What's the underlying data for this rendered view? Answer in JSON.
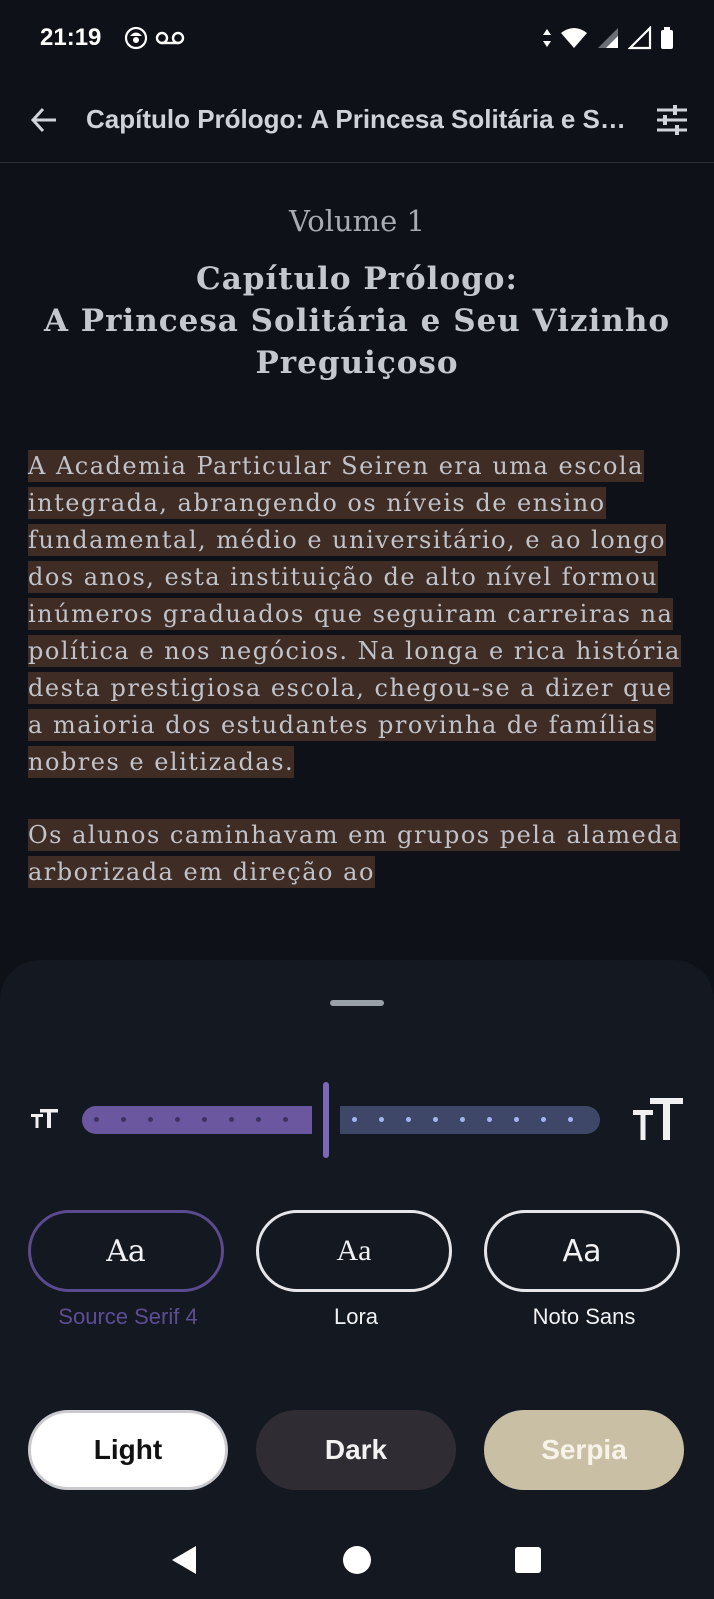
{
  "status_bar": {
    "time": "21:19",
    "icons": [
      "notification-avatar-icon",
      "voicemail-icon",
      "wifi-icon",
      "signal-icon",
      "signal-empty-icon",
      "battery-icon"
    ]
  },
  "app_bar": {
    "title": "Capítulo Prólogo: A Princesa Solitária e Seu Vizinho Preguiçoso",
    "back_icon": "arrow-left-icon",
    "settings_icon": "tune-icon"
  },
  "content": {
    "volume": "Volume 1",
    "chapter_title_line1": "Capítulo Prólogo:",
    "chapter_title_line2": "A Princesa Solitária e Seu Vizinho",
    "chapter_title_line3": "Preguiçoso",
    "paragraph1": "A Academia Particular Seiren era uma escola integrada, abrangendo os níveis de ensino fundamental, médio e universitário, e ao longo dos anos, esta instituição de alto nível formou inúmeros graduados que seguiram carreiras na política e nos negócios. Na longa e rica história desta prestigiosa escola, chegou-se a dizer que a maioria dos estudantes provinha de famílias nobres e elitizadas.",
    "paragraph2": "Os alunos caminhavam em grupos pela alameda arborizada em direção ao"
  },
  "settings_sheet": {
    "font_size": {
      "small_icon": "text-size-small-icon",
      "large_icon": "text-size-large-icon",
      "level_fraction": 0.47
    },
    "fonts": [
      {
        "sample": "Aa",
        "label": "Source Serif 4",
        "selected": true
      },
      {
        "sample": "Aa",
        "label": "Lora",
        "selected": false
      },
      {
        "sample": "Aa",
        "label": "Noto Sans",
        "selected": false
      }
    ],
    "themes": [
      {
        "label": "Light"
      },
      {
        "label": "Dark"
      },
      {
        "label": "Serpia"
      }
    ],
    "colors": {
      "accent": "#6a579f",
      "highlight": "#3f2c24",
      "sepia": "#c8bfa4"
    }
  },
  "nav_bar": {
    "icons": [
      "back-triangle-icon",
      "home-circle-icon",
      "recents-square-icon"
    ]
  }
}
